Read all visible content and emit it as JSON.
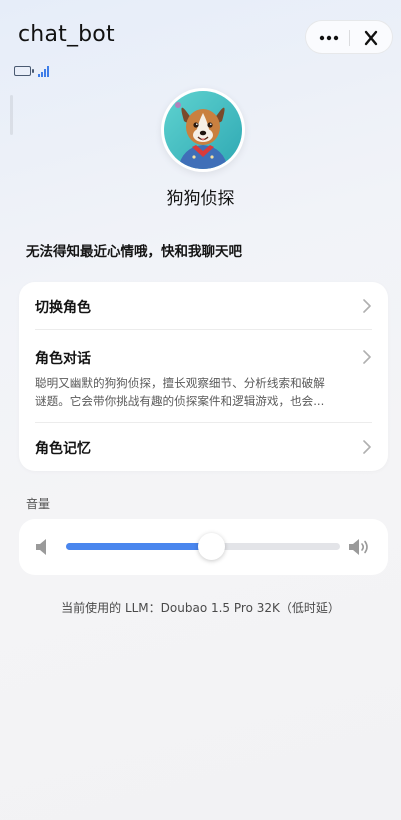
{
  "header": {
    "title": "chat_bot",
    "more_icon": "more-dots-icon",
    "close_icon": "close-icon"
  },
  "status": {
    "battery_icon": "battery-icon",
    "signal_icon": "signal-icon"
  },
  "role": {
    "avatar_icon": "dog-detective-avatar",
    "name": "狗狗侦探",
    "mood": "无法得知最近心情哦，快和我聊天吧"
  },
  "menu": {
    "switch_role": "切换角色",
    "role_chat": {
      "title": "角色对话",
      "desc_line1": "聪明又幽默的狗狗侦探，擅长观察细节、分析线索和破解",
      "desc_line2": "谜题。它会带你挑战有趣的侦探案件和逻辑游戏，也会..."
    },
    "role_memory": "角色记忆"
  },
  "volume": {
    "label": "音量",
    "level": 0.53,
    "low_icon": "speaker-low-icon",
    "high_icon": "speaker-high-icon"
  },
  "footer": {
    "llm_text": "当前使用的 LLM：Doubao 1.5 Pro 32K（低时延）"
  },
  "colors": {
    "accent": "#4a86ee",
    "background": "#f2f2f4",
    "card": "#ffffff"
  }
}
